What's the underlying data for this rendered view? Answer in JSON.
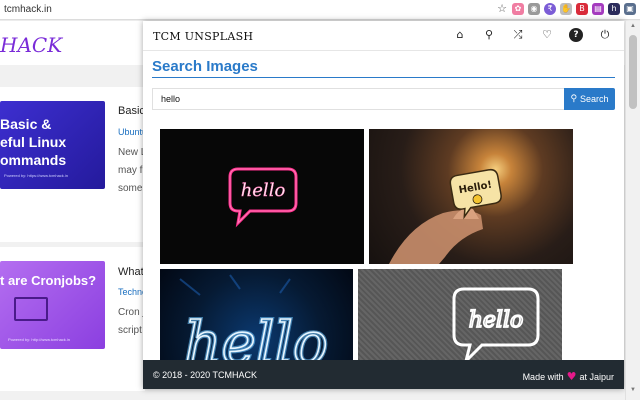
{
  "browser": {
    "url": "tcmhack.in"
  },
  "background_page": {
    "logo": "HACK",
    "cards": [
      {
        "thumb_text": "Basic &\neful Linux\nommands",
        "title": "Basic",
        "category": "Ubuntu",
        "excerpt_1": "New L",
        "excerpt_2": "may f",
        "excerpt_3": "some"
      },
      {
        "thumb_text": "t are Cronjobs?",
        "title": "What",
        "category": "Techno",
        "excerpt_1": "Cron j",
        "excerpt_2": "script"
      }
    ],
    "bottom_right": "——  —— ——"
  },
  "popup": {
    "brand": "TCM UNSPLASH",
    "nav_icons": [
      "home-icon",
      "search-icon",
      "shuffle-icon",
      "heart-icon",
      "help-icon",
      "power-icon"
    ],
    "heading": "Search Images",
    "search": {
      "value": "hello",
      "button_label": "Search"
    },
    "images": [
      {
        "text": "hello",
        "desc": "pink neon"
      },
      {
        "text": "Hello!",
        "desc": "yellow sign"
      },
      {
        "text": "hello",
        "desc": "blue neon"
      },
      {
        "text": "hello",
        "desc": "white neon"
      }
    ],
    "footer": {
      "copyright": "© 2018 - 2020 TCMHACK",
      "made_with": "Made with",
      "at": "at Jaipur"
    }
  },
  "colors": {
    "accent": "#2a7ac9",
    "footer_bg": "#222b32",
    "heart": "#e6198a"
  }
}
